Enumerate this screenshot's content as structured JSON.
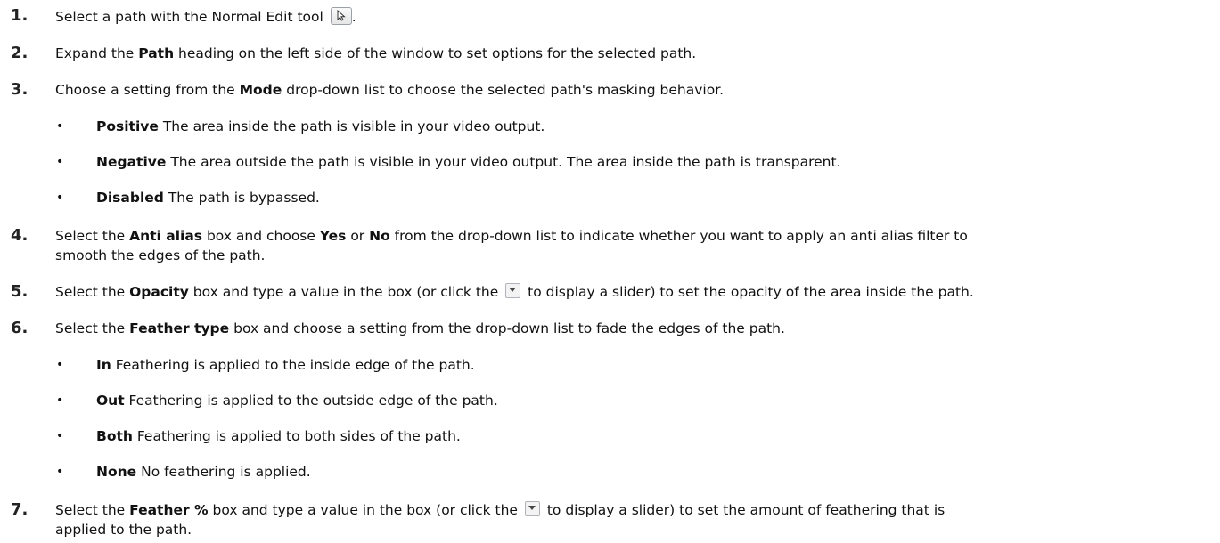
{
  "steps": [
    {
      "num": "1.",
      "pre": "Select a path with the Normal Edit tool",
      "post": "."
    },
    {
      "num": "2.",
      "t1": "Expand the ",
      "b1": "Path",
      "t2": " heading on the left side of the window to set options for the selected path."
    },
    {
      "num": "3.",
      "t1": "Choose a setting from the ",
      "b1": "Mode",
      "t2": " drop-down list to choose the selected path's masking behavior."
    },
    {
      "num": "4.",
      "t1": "Select the ",
      "b1": "Anti alias",
      "t2": " box and choose ",
      "b2": "Yes",
      "t3": " or ",
      "b3": "No",
      "t4": " from the drop-down list to indicate whether you want to apply an anti alias filter to",
      "line2": "smooth the edges of the path."
    },
    {
      "num": "5.",
      "t1": "Select the ",
      "b1": "Opacity",
      "t2": " box and type a value in the box (or click the",
      "t3": "to display a slider) to set the opacity of the area inside the path."
    },
    {
      "num": "6.",
      "t1": "Select the ",
      "b1": "Feather type",
      "t2": " box and choose a setting from the drop-down list to fade the edges of the path."
    },
    {
      "num": "7.",
      "t1": "Select the ",
      "b1": "Feather %",
      "t2": " box and type a value in the box (or click the",
      "t3": "to display a slider) to set the amount of feathering that is",
      "line2": "applied to the path."
    }
  ],
  "mode_bullets": [
    {
      "term": "Positive",
      "desc": " The area inside the path is visible in your video output."
    },
    {
      "term": "Negative",
      "desc": " The area outside the path is visible in your video output. The area inside the path is transparent."
    },
    {
      "term": "Disabled",
      "desc": " The path is bypassed."
    }
  ],
  "feather_bullets": [
    {
      "term": "In",
      "desc": " Feathering is applied to the inside edge of the path."
    },
    {
      "term": "Out",
      "desc": " Feathering is applied to the outside edge of the path."
    },
    {
      "term": "Both",
      "desc": " Feathering is applied to both sides of the path."
    },
    {
      "term": "None",
      "desc": " No feathering is applied."
    }
  ],
  "bullet_char": "•",
  "icons": {
    "normal_edit": "normal-edit-tool-icon",
    "dropdown": "dropdown-arrow-icon"
  }
}
